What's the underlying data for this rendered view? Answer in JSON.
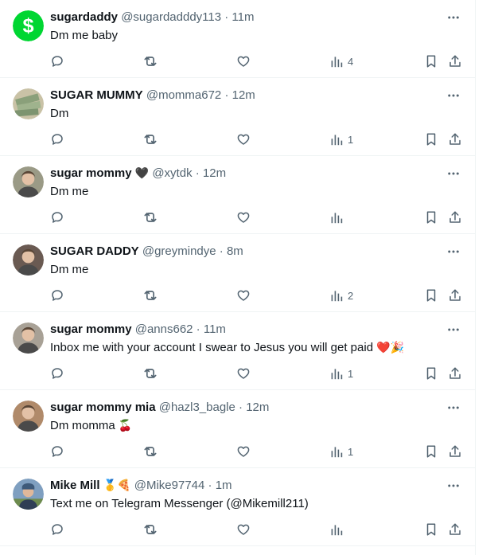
{
  "tweets": [
    {
      "name": "sugardaddy",
      "handle": "@sugardadddy113",
      "sep": "·",
      "time": "11m",
      "text": "Dm me baby",
      "views": "4",
      "name_emoji": "",
      "text_emoji": "",
      "avatar": "cash-app-logo",
      "avatar_color": "#00d632"
    },
    {
      "name": "SUGAR MUMMY",
      "handle": "@momma672",
      "sep": "·",
      "time": "12m",
      "text": "Dm",
      "views": "1",
      "name_emoji": "",
      "text_emoji": "",
      "avatar": "money-photo",
      "avatar_color": "#8aa07a"
    },
    {
      "name": "sugar mommy",
      "handle": "@xytdk",
      "sep": "·",
      "time": "12m",
      "text": "Dm me",
      "views": "",
      "name_emoji": "🖤",
      "text_emoji": "",
      "avatar": "woman-photo",
      "avatar_color": "#9a9a86"
    },
    {
      "name": "SUGAR DADDY",
      "handle": "@greymindye",
      "sep": "·",
      "time": "8m",
      "text": "Dm me",
      "views": "2",
      "name_emoji": "",
      "text_emoji": "",
      "avatar": "man-photo",
      "avatar_color": "#6a5a52"
    },
    {
      "name": "sugar mommy",
      "handle": "@anns662",
      "sep": "·",
      "time": "11m",
      "text": "Inbox me with your account I swear to Jesus you will get paid",
      "views": "1",
      "name_emoji": "",
      "text_emoji": "❤️🎉",
      "avatar": "woman-photo-2",
      "avatar_color": "#a8a196"
    },
    {
      "name": "sugar mommy mia",
      "handle": "@hazl3_bagle",
      "sep": "·",
      "time": "12m",
      "text": "Dm momma",
      "views": "1",
      "name_emoji": "",
      "text_emoji": "🍒",
      "avatar": "woman-photo-3",
      "avatar_color": "#b08a6a"
    },
    {
      "name": "Mike Mill",
      "handle": "@Mike97744",
      "sep": "·",
      "time": "1m",
      "text": "Text me on Telegram Messenger (@Mikemill211)",
      "views": "",
      "name_emoji": "🥇🍕",
      "text_emoji": "",
      "avatar": "man-outdoor-photo",
      "avatar_color": "#7f9fc0"
    }
  ],
  "icons": {
    "reply": "reply-icon",
    "retweet": "retweet-icon",
    "like": "heart-icon",
    "views": "views-icon",
    "bookmark": "bookmark-icon",
    "share": "share-icon",
    "more": "more-icon"
  }
}
